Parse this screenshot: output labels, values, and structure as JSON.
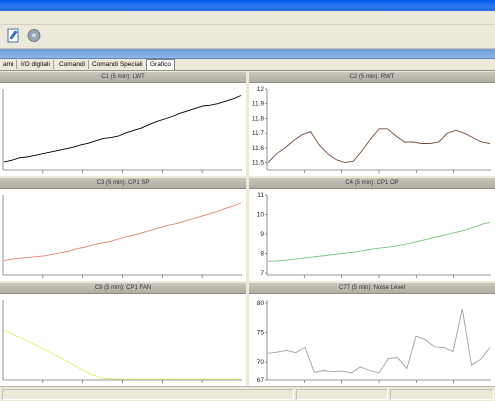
{
  "tabs": [
    {
      "label": "ami",
      "active": false
    },
    {
      "label": "I/O digitali",
      "active": false
    },
    {
      "label": "Comandi",
      "active": false
    },
    {
      "label": "Comandi Speciali",
      "active": false
    },
    {
      "label": "Grafico",
      "active": true
    }
  ],
  "toolbar": {
    "icons": [
      "edit-document-icon",
      "disk-drive-icon"
    ]
  },
  "colors": {
    "accent": "#0058e6",
    "tab_band": "#7ea8de",
    "panel_header": "#bdbab0"
  },
  "panels": [
    {
      "title": "C1 (5 min): LWT",
      "color": "#000000",
      "yticks": [],
      "ylim": [
        0,
        1
      ],
      "values": [
        0.1,
        0.12,
        0.15,
        0.16,
        0.18,
        0.2,
        0.22,
        0.24,
        0.26,
        0.28,
        0.31,
        0.33,
        0.36,
        0.39,
        0.4,
        0.42,
        0.46,
        0.49,
        0.52,
        0.56,
        0.6,
        0.63,
        0.66,
        0.7,
        0.73,
        0.76,
        0.79,
        0.8,
        0.82,
        0.85,
        0.88,
        0.92
      ]
    },
    {
      "title": "C2 (5 min): RWT",
      "color": "#7a4b3a",
      "yticks": [
        "12",
        "11.9",
        "11.8",
        "11.7",
        "11.6",
        "11.5"
      ],
      "ylim": [
        11.45,
        12.0
      ],
      "values": [
        11.5,
        11.56,
        11.6,
        11.65,
        11.69,
        11.71,
        11.62,
        11.56,
        11.52,
        11.5,
        11.51,
        11.58,
        11.66,
        11.73,
        11.73,
        11.68,
        11.64,
        11.64,
        11.63,
        11.63,
        11.64,
        11.7,
        11.72,
        11.7,
        11.67,
        11.64,
        11.63
      ]
    },
    {
      "title": "C3 (5 min): CP1 SP",
      "color": "#e0876a",
      "yticks": [],
      "ylim": [
        0,
        1
      ],
      "values": [
        0.18,
        0.2,
        0.21,
        0.22,
        0.23,
        0.24,
        0.26,
        0.28,
        0.3,
        0.33,
        0.35,
        0.38,
        0.4,
        0.42,
        0.45,
        0.48,
        0.5,
        0.53,
        0.56,
        0.59,
        0.62,
        0.64,
        0.67,
        0.7,
        0.73,
        0.76,
        0.79,
        0.83,
        0.86,
        0.9
      ]
    },
    {
      "title": "C4 (5 min): CP1 OP",
      "color": "#7cc57c",
      "yticks": [
        "11",
        "10",
        "9",
        "8",
        "7"
      ],
      "ylim": [
        6.9,
        11.0
      ],
      "values": [
        7.6,
        7.62,
        7.65,
        7.7,
        7.75,
        7.8,
        7.85,
        7.9,
        7.95,
        8.0,
        8.05,
        8.1,
        8.18,
        8.25,
        8.3,
        8.35,
        8.42,
        8.5,
        8.6,
        8.7,
        8.8,
        8.9,
        9.0,
        9.1,
        9.2,
        9.35,
        9.5,
        9.6
      ]
    },
    {
      "title": "C9 (5 min): CP1 FAN",
      "color": "#e3ef6a",
      "yticks": [],
      "ylim": [
        0,
        1
      ],
      "values": [
        0.62,
        0.55,
        0.48,
        0.4,
        0.32,
        0.24,
        0.15,
        0.07,
        0.02,
        0.01,
        0.01,
        0.01,
        0.01,
        0.01,
        0.01,
        0.01,
        0.01,
        0.01,
        0.01,
        0.01
      ]
    },
    {
      "title": "C77 (5 min): Noise Level",
      "color": "#a0a0a0",
      "yticks": [
        "80",
        "75",
        "70",
        "67"
      ],
      "ylim": [
        67.0,
        80.5
      ],
      "values": [
        71.5,
        71.7,
        72.0,
        71.6,
        72.5,
        68.3,
        68.6,
        68.4,
        68.5,
        68.2,
        69.2,
        68.6,
        68.2,
        70.6,
        70.8,
        68.9,
        74.4,
        73.8,
        72.6,
        72.5,
        71.8,
        79.0,
        69.5,
        70.5,
        72.5
      ]
    }
  ]
}
